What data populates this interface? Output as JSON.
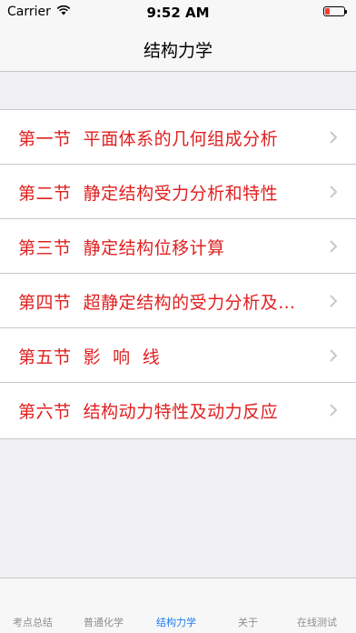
{
  "status": {
    "carrier": "Carrier",
    "time": "9:52 AM"
  },
  "nav": {
    "title": "结构力学"
  },
  "list": {
    "items": [
      {
        "label": "第一节  平面体系的几何组成分析"
      },
      {
        "label": "第二节  静定结构受力分析和特性"
      },
      {
        "label": "第三节  静定结构位移计算"
      },
      {
        "label": "第四节  超静定结构的受力分析及…"
      },
      {
        "label": "第五节  影  响  线"
      },
      {
        "label": "第六节  结构动力特性及动力反应"
      }
    ]
  },
  "tabs": [
    {
      "label": "考点总结"
    },
    {
      "label": "普通化学"
    },
    {
      "label": "结构力学"
    },
    {
      "label": "关于"
    },
    {
      "label": "在线测试"
    }
  ],
  "colors": {
    "accent": "#1e7cf0",
    "item_text": "#e02020",
    "background": "#efeff4",
    "battery": "#ff3b30"
  },
  "icons": {
    "row_disclosure": "chevron-right-icon",
    "wifi": "wifi-icon",
    "battery": "battery-icon"
  }
}
